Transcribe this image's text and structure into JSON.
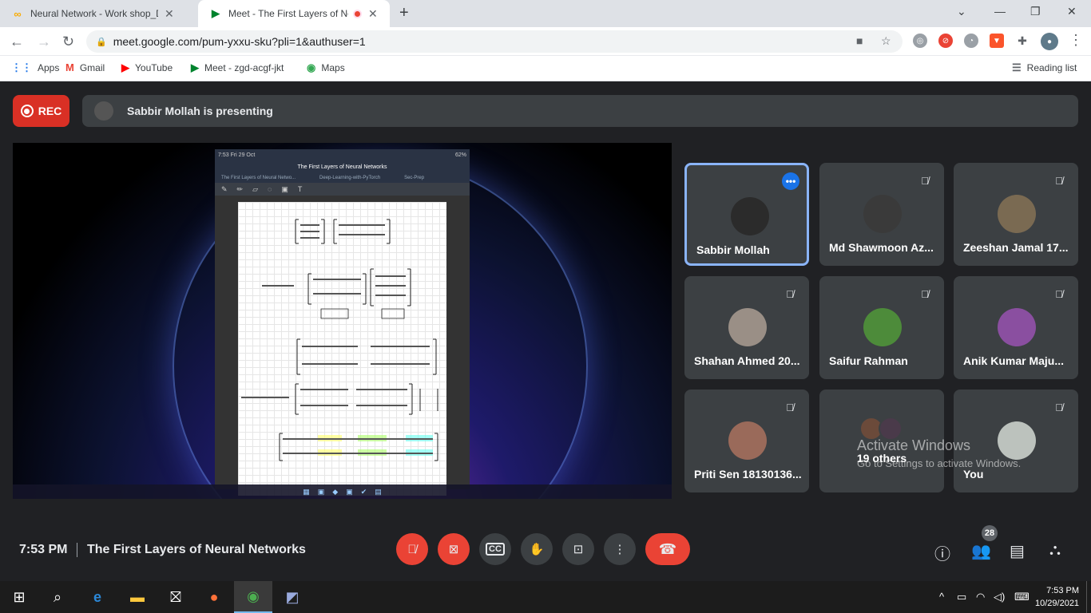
{
  "browser": {
    "tabs": [
      {
        "title": "Neural Network - Work shop_Day",
        "icon": "colab-icon"
      },
      {
        "title": "Meet - The First Layers of Ne",
        "icon": "meet-icon",
        "active": true
      }
    ],
    "url": "meet.google.com/pum-yxxu-sku?pli=1&authuser=1",
    "bookmarks": [
      "Apps",
      "Gmail",
      "YouTube",
      "Meet - zgd-acgf-jkt",
      "Maps"
    ],
    "reading_list": "Reading list"
  },
  "meet": {
    "rec_label": "REC",
    "presenting_text": "Sabbir Mollah is presenting",
    "shared_screen": {
      "status_left": "7:53  Fri 29 Oct",
      "status_right": "62%",
      "doc_title": "The First Layers of Neural Networks",
      "doc_tabs": [
        "The First Layers of Neural Netwo...",
        "Deep-Learning-with-PyTorch",
        "Sec-Prep"
      ]
    },
    "participants": [
      {
        "name": "Sabbir Mollah",
        "selected": true,
        "color": "#2b2b2b"
      },
      {
        "name": "Md Shawmoon Az...",
        "muted": true,
        "color": "#3a3a3a"
      },
      {
        "name": "Zeeshan Jamal 17...",
        "muted": true,
        "color": "#7a6a52"
      },
      {
        "name": "Shahan Ahmed 20...",
        "muted": true,
        "color": "#9a8f86"
      },
      {
        "name": "Saifur Rahman",
        "muted": true,
        "color": "#4d8b3a"
      },
      {
        "name": "Anik Kumar Maju...",
        "muted": true,
        "color": "#8a4fa0"
      },
      {
        "name": "Priti Sen 18130136...",
        "muted": true,
        "color": "#9a6a5a"
      },
      {
        "name": "You",
        "muted": true,
        "color": "#bcc2bd"
      }
    ],
    "others_label": "19 others",
    "time": "7:53 PM",
    "meeting_title": "The First Layers of Neural Networks",
    "participant_count": "28"
  },
  "windows": {
    "activate_title": "Activate Windows",
    "activate_sub": "Go to Settings to activate Windows.",
    "clock_time": "7:53 PM",
    "clock_date": "10/29/2021"
  }
}
